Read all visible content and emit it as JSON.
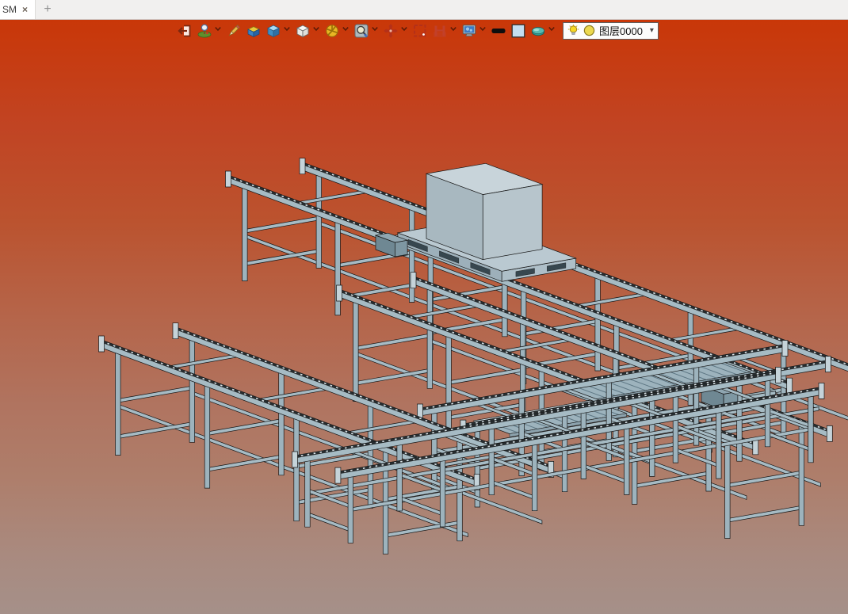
{
  "window": {
    "tab_title": "SM",
    "tab_close_glyph": "×",
    "new_tab_glyph": "+"
  },
  "toolbar": {
    "items": [
      {
        "name": "exit-icon",
        "dropdown": false
      },
      {
        "name": "scene-tree-icon",
        "dropdown": true
      },
      {
        "name": "sketch-pencil-icon",
        "dropdown": false
      },
      {
        "name": "solid-box-icon",
        "dropdown": false
      },
      {
        "name": "shaded-view-icon",
        "dropdown": true
      },
      {
        "name": "wireframe-view-icon",
        "dropdown": true
      },
      {
        "name": "view-orientation-icon",
        "dropdown": true
      },
      {
        "name": "zoom-icon",
        "dropdown": true
      },
      {
        "name": "pan-icon",
        "dropdown": true
      },
      {
        "name": "select-box-icon",
        "dropdown": false
      },
      {
        "name": "clip-plane-icon",
        "dropdown": true
      },
      {
        "name": "display-settings-icon",
        "dropdown": true
      },
      {
        "name": "line-width-swatch",
        "dropdown": false
      },
      {
        "name": "background-color-swatch",
        "dropdown": false
      },
      {
        "name": "material-icon",
        "dropdown": true
      }
    ],
    "layer_selector": {
      "value": "图层0000",
      "visibility_icon": "lightbulb-icon",
      "color_icon": "layer-color-icon"
    }
  },
  "viewport": {
    "model_description": "pallet conveyor transfer system with cube load",
    "background_top_color": "#c93708",
    "background_bottom_color": "#a59089",
    "steel_color": "#a6bbc4",
    "edge_color": "#161616"
  }
}
